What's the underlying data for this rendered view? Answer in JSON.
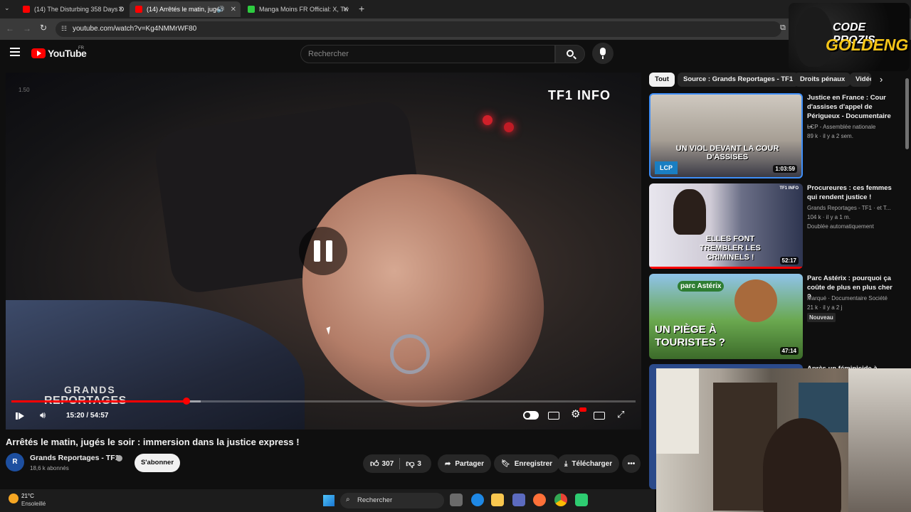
{
  "browser": {
    "tabs": [
      {
        "title": "(14) The Disturbing 358 Days D"
      },
      {
        "title": "(14) Arrêtés le matin, jugés"
      },
      {
        "title": "Manga Moins FR Official: X, Tw"
      }
    ],
    "new_tab": "+",
    "url": "youtube.com/watch?v=Kg4NMMrWF80"
  },
  "youtube": {
    "logo": "YouTube",
    "region": "FR",
    "search_placeholder": "Rechercher"
  },
  "video": {
    "overlay_logo": "TF1 INFO",
    "corner_text": "1.50",
    "watermark_line1": "GRANDS",
    "watermark_line2": "REPORTAGES",
    "time": "15:20 / 54:57",
    "progress": 0.28,
    "title": "Arrêtés le matin, jugés le soir : immersion dans la justice express !",
    "channel": "Grands Reportages - TF1",
    "subscribers": "18,6 k abonnés",
    "subscribe_label": "S'abonner",
    "likes": "307",
    "dislikes": "3",
    "share_label": "Partager",
    "save_label": "Enregistrer",
    "download_label": "Télécharger"
  },
  "chips": [
    "Tout",
    "Source : Grands Reportages - TF1",
    "Droits pénaux",
    "Vidéo"
  ],
  "recommendations": [
    {
      "title": "Justice en France : Cour d'assises d'appel de Périgueux - Documentaire ...",
      "channel": "LCP - Assemblée nationale",
      "stats": "89 k · il y a 2 sem.",
      "badge": "",
      "duration": "1:03:59",
      "thumb_text": "UN VIOL DEVANT LA COUR D'ASSISES",
      "thumb_logo": "LCP"
    },
    {
      "title": "Procureures : ces femmes qui rendent justice !",
      "channel": "Grands Reportages - TF1 · et T...",
      "stats": "104 k · il y a 1 m.",
      "badge": "Doublée automatiquement",
      "duration": "52:17",
      "thumb_text": "ELLES FONT TREMBLER LES CRIMINELS !",
      "thumb_logo": "TF1 INFO"
    },
    {
      "title": "Parc Astérix : pourquoi ça coûte de plus en plus cher ?",
      "channel": "Marqué · Documentaire Société",
      "stats": "21 k · il y a 2 j",
      "badge": "Nouveau",
      "duration": "47:14",
      "thumb_text": "UN PIÈGE À TOURISTES ?",
      "thumb_logo": "parc Astérix"
    },
    {
      "title": "Après un féminicide à ...",
      "channel": "",
      "stats": "",
      "badge": "",
      "duration": "",
      "thumb_text": "",
      "thumb_logo": ""
    }
  ],
  "overlay": {
    "brand_line1": "CODE PROZIS",
    "brand_line2": "GOLDENG"
  },
  "taskbar": {
    "temperature": "21°C",
    "weather": "Ensoleillé",
    "search_label": "Rechercher"
  },
  "colors": {
    "accent_red": "#ff0000",
    "background": "#0f0f0f",
    "chip_active": "#f1f1f1"
  }
}
